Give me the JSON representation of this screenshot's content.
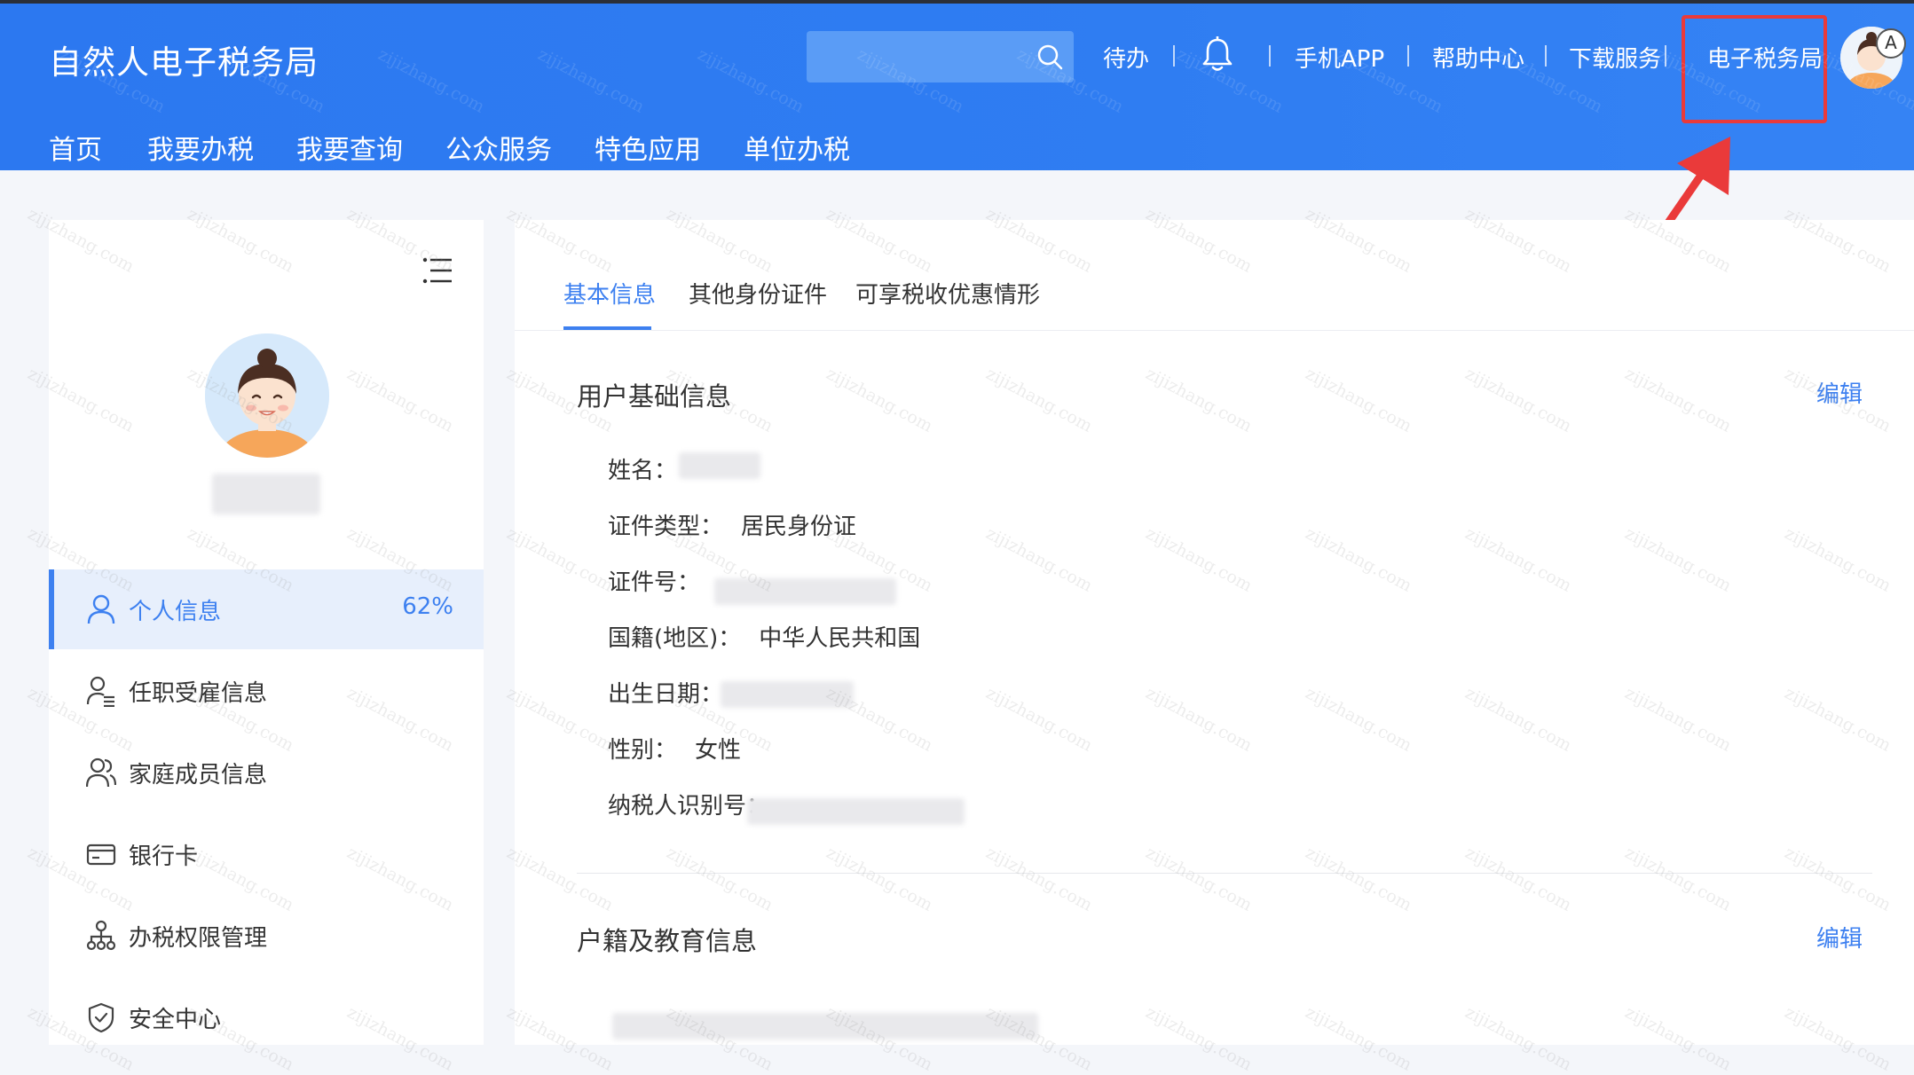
{
  "header": {
    "title": "自然人电子税务局",
    "search": {
      "placeholder": ""
    },
    "top_nav": [
      "待办",
      "手机APP",
      "帮助中心",
      "下载服务",
      "电子税务局"
    ],
    "main_nav": [
      "首页",
      "我要办税",
      "我要查询",
      "公众服务",
      "特色应用",
      "单位办税"
    ],
    "translate_glyph": "A"
  },
  "sidebar": {
    "items": [
      {
        "label": "个人信息",
        "percent": "62%",
        "icon": "person-icon",
        "active": true
      },
      {
        "label": "任职受雇信息",
        "icon": "person-list-icon"
      },
      {
        "label": "家庭成员信息",
        "icon": "family-icon"
      },
      {
        "label": "银行卡",
        "icon": "bank-card-icon"
      },
      {
        "label": "办税权限管理",
        "icon": "org-tree-icon"
      },
      {
        "label": "安全中心",
        "icon": "shield-check-icon"
      }
    ]
  },
  "content": {
    "tabs": [
      "基本信息",
      "其他身份证件",
      "可享税收优惠情形"
    ],
    "section1": {
      "title": "用户基础信息",
      "edit": "编辑",
      "fields": [
        {
          "label": "姓名：",
          "value": ""
        },
        {
          "label": "证件类型：",
          "value": "居民身份证"
        },
        {
          "label": "证件号：",
          "value": ""
        },
        {
          "label": "国籍(地区)：",
          "value": "中华人民共和国"
        },
        {
          "label": "出生日期：",
          "value": ""
        },
        {
          "label": "性别：",
          "value": "女性"
        },
        {
          "label": "纳税人识别号：",
          "value": ""
        }
      ]
    },
    "section2": {
      "title": "户籍及教育信息",
      "edit": "编辑"
    }
  },
  "watermark_text": "zijizhang.com",
  "colors": {
    "header_blue": "#2f7df2",
    "accent": "#3d80f0",
    "highlight_red": "#ea3a3a"
  }
}
